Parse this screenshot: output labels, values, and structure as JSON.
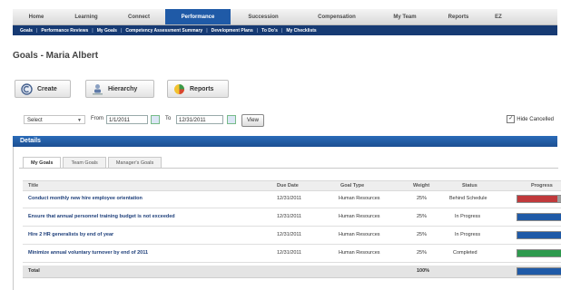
{
  "topnav": {
    "tabs": [
      "Home",
      "Learning",
      "Connect",
      "Performance",
      "Succession",
      "Compensation",
      "My Team",
      "Reports",
      "EZ"
    ]
  },
  "subnav": {
    "items": [
      "Goals",
      "Performance Reviews",
      "My Goals",
      "Competency Assessment Summary",
      "Development Plans",
      "To Do's",
      "My Checklists"
    ]
  },
  "page": {
    "title": "Goals - Maria Albert"
  },
  "actions": {
    "create": "Create",
    "hierarchy": "Hierarchy",
    "reports": "Reports"
  },
  "filters": {
    "select_value": "Select",
    "from_label": "From",
    "from_value": "1/1/2011",
    "to_label": "To",
    "to_value": "12/31/2011",
    "view_label": "View",
    "hide_cancelled_label": "Hide Cancelled",
    "hide_cancelled_checked": true
  },
  "section": {
    "title": "Details"
  },
  "goal_tabs": [
    "My Goals",
    "Team Goals",
    "Manager's Goals"
  ],
  "table": {
    "headers": {
      "title": "Title",
      "due": "Due Date",
      "type": "Goal Type",
      "weight": "Weight",
      "status": "Status",
      "progress": "Progress"
    },
    "rows": [
      {
        "title": "Conduct monthly new hire employee orientation",
        "due": "12/31/2011",
        "type": "Human Resources",
        "weight": "25%",
        "status": "Behind Schedule",
        "progress": 0.75,
        "color": "#c0393b"
      },
      {
        "title": "Ensure that annual personnel training budget is not exceeded",
        "due": "12/31/2011",
        "type": "Human Resources",
        "weight": "25%",
        "status": "In Progress",
        "progress": 0.85,
        "color": "#1f5aa7"
      },
      {
        "title": "Hire 2 HR generalists by end of year",
        "due": "12/31/2011",
        "type": "Human Resources",
        "weight": "25%",
        "status": "In Progress",
        "progress": 0.85,
        "color": "#1f5aa7"
      },
      {
        "title": "Minimize annual voluntary turnover by end of 2011",
        "due": "12/31/2011",
        "type": "Human Resources",
        "weight": "25%",
        "status": "Completed",
        "progress": 1.0,
        "color": "#2e9a4e"
      }
    ],
    "total": {
      "label": "Total",
      "weight": "100%",
      "progress": 0.85,
      "color": "#1f5aa7"
    }
  }
}
